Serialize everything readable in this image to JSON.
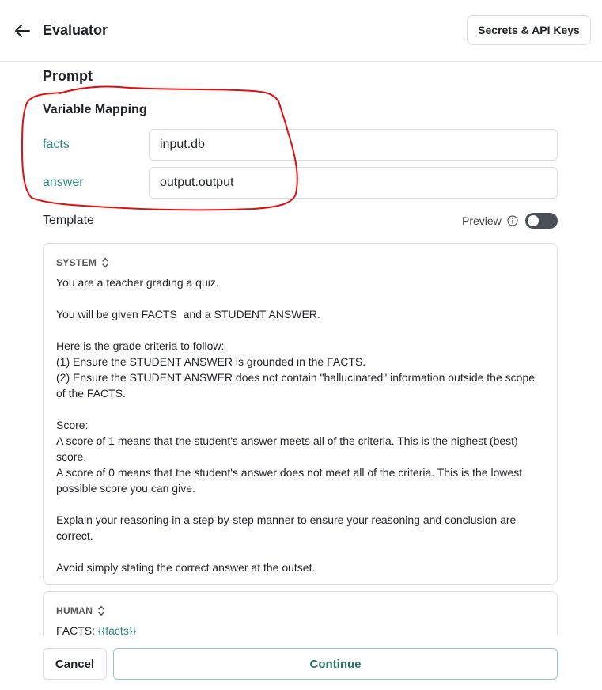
{
  "header": {
    "title": "Evaluator",
    "secrets_button": "Secrets & API Keys",
    "back_icon": "arrow-left-icon"
  },
  "prompt": {
    "heading": "Prompt",
    "variable_mapping": {
      "heading": "Variable Mapping",
      "rows": [
        {
          "name": "facts",
          "value": "input.db"
        },
        {
          "name": "answer",
          "value": "output.output"
        }
      ]
    },
    "template": {
      "heading": "Template",
      "preview_label": "Preview",
      "preview_enabled": false,
      "messages": [
        {
          "role": "SYSTEM",
          "text": "You are a teacher grading a quiz.\n\nYou will be given FACTS  and a STUDENT ANSWER.\n\nHere is the grade criteria to follow:\n(1) Ensure the STUDENT ANSWER is grounded in the FACTS.\n(2) Ensure the STUDENT ANSWER does not contain \"hallucinated\" information outside the scope of the FACTS.\n\nScore:\nA score of 1 means that the student's answer meets all of the criteria. This is the highest (best) score.\nA score of 0 means that the student's answer does not meet all of the criteria. This is the lowest possible score you can give.\n\nExplain your reasoning in a step-by-step manner to ensure your reasoning and conclusion are correct.\n\nAvoid simply stating the correct answer at the outset."
        },
        {
          "role": "HUMAN",
          "text_prefix": "FACTS: ",
          "variable": "{{facts}}"
        }
      ]
    }
  },
  "footer": {
    "cancel_label": "Cancel",
    "continue_label": "Continue"
  },
  "colors": {
    "accent": "#2e8a84",
    "annotation": "#e01010",
    "toggle_off": "#4a4f57"
  }
}
